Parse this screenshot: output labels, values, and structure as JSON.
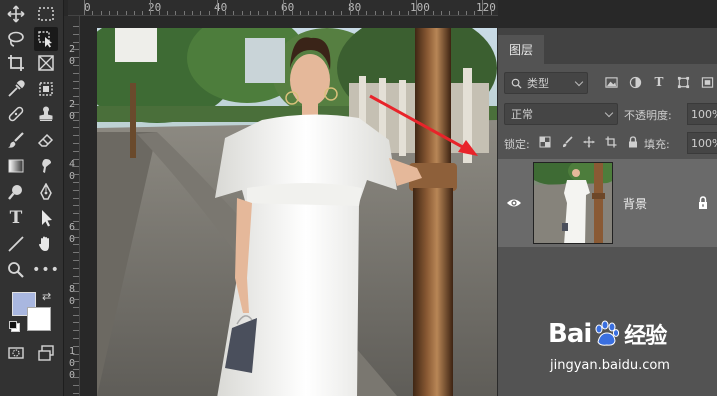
{
  "ruler_top_labels": [
    "0",
    "20",
    "40",
    "60",
    "80",
    "100",
    "120"
  ],
  "ruler_left_labels": [
    "2",
    "0",
    "2",
    "0",
    "4",
    "0",
    "6",
    "0",
    "8",
    "0",
    "1",
    "0",
    "0"
  ],
  "layers_panel": {
    "tab_label": "图层",
    "filter_label": "类型",
    "blend_mode": "正常",
    "opacity_label": "不透明度:",
    "opacity_value": "100%",
    "lock_label": "锁定:",
    "fill_label": "填充:",
    "fill_value": "100%",
    "layers": [
      {
        "name": "背景",
        "visible": true,
        "locked": true
      }
    ]
  },
  "colors": {
    "foreground": "#a9b7e0",
    "background": "#ffffff",
    "annotation_arrow": "#e8242a"
  },
  "watermark": {
    "logo_text_1": "Bai",
    "logo_text_2": "经验",
    "url": "jingyan.baidu.com"
  }
}
